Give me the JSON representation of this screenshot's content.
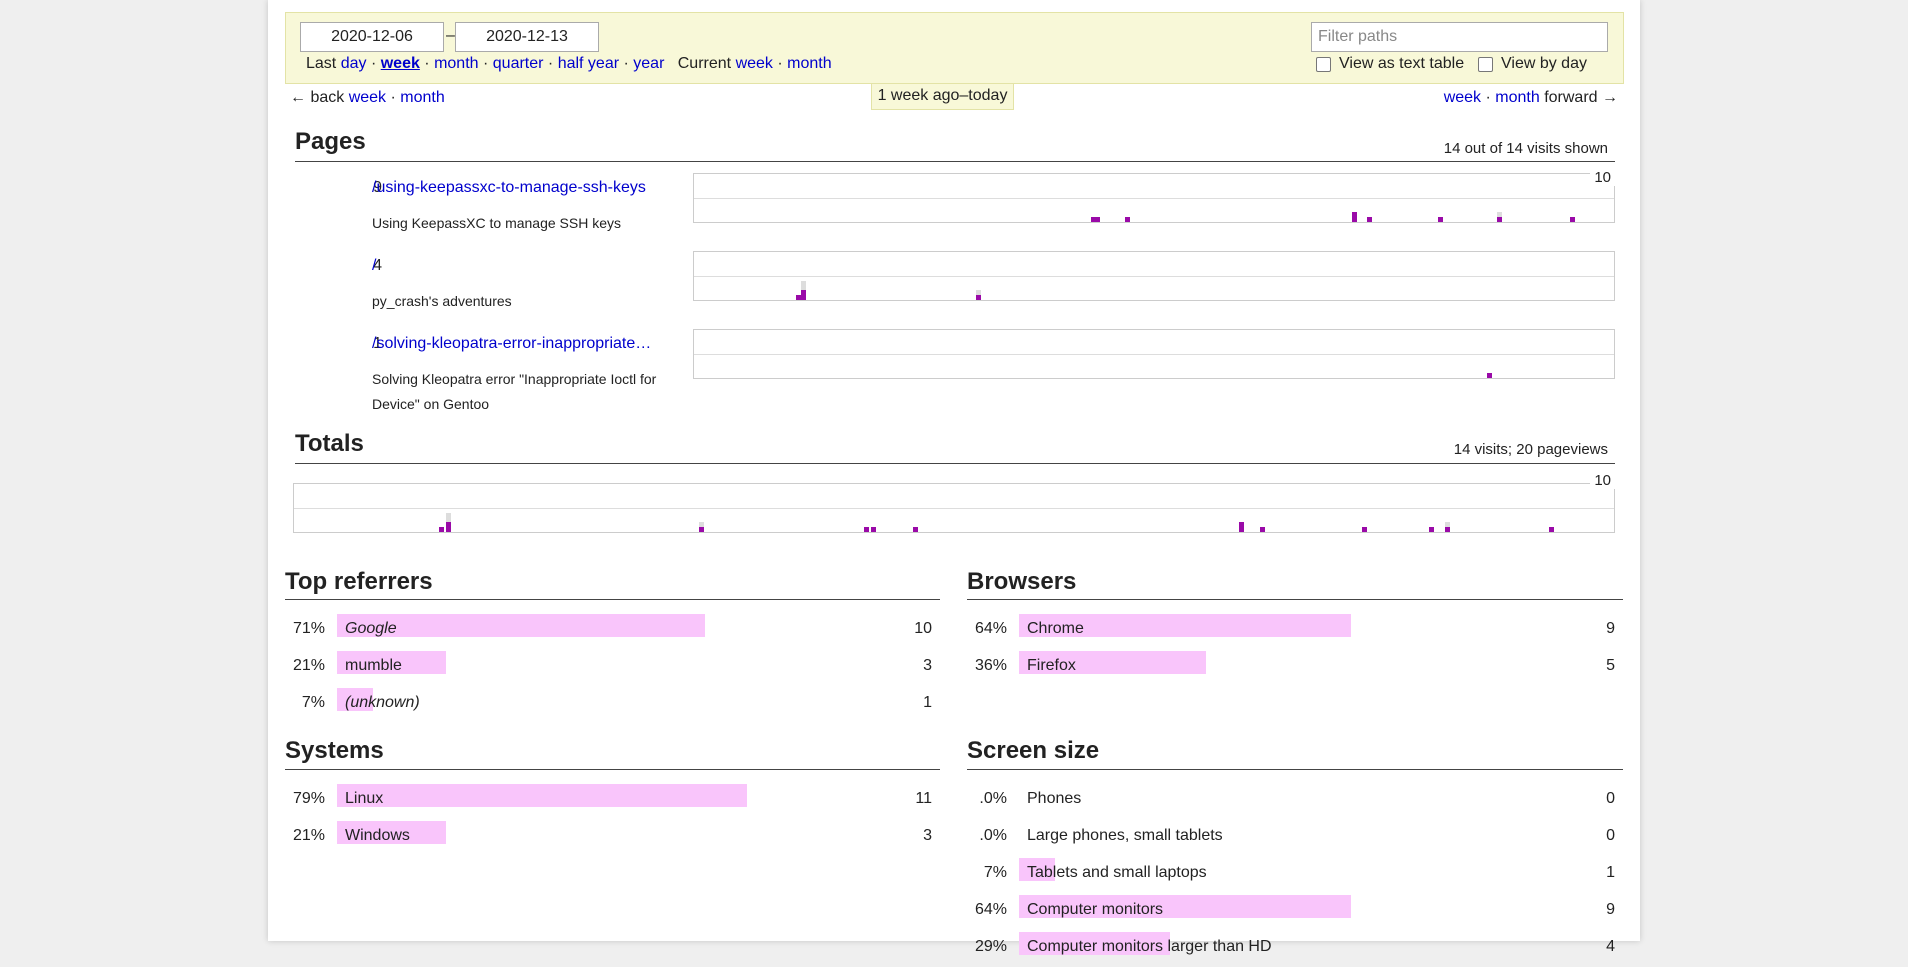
{
  "filter": {
    "start_date": "2020-12-06",
    "end_date": "2020-12-13",
    "dash": "–",
    "last_label": "Last",
    "last_periods": [
      "day",
      "week",
      "month",
      "quarter",
      "half year",
      "year"
    ],
    "selected_period": "week",
    "current_label": "Current",
    "current_periods": [
      "week",
      "month"
    ],
    "filter_placeholder": "Filter paths",
    "view_text_table": "View as text table",
    "view_by_day": "View by day"
  },
  "nav": {
    "back_label": "← back",
    "back_week": "week",
    "back_month": "month",
    "forward_week": "week",
    "forward_month": "month",
    "forward_label": "forward →",
    "sep": "·",
    "current_range": "1 week ago–today"
  },
  "pages": {
    "title": "Pages",
    "info": "14 out of 14 visits shown",
    "max_label": "10",
    "rows": [
      {
        "count": "9",
        "path": "/using-keepassxc-to-manage-ssh-keys",
        "title": "Using KeepassXC to manage SSH keys",
        "bars": [
          {
            "x": 0.431,
            "pv": 1,
            "vi": 1
          },
          {
            "x": 0.436,
            "pv": 1,
            "vi": 1
          },
          {
            "x": 0.469,
            "pv": 1,
            "vi": 1
          },
          {
            "x": 0.715,
            "pv": 2,
            "vi": 2
          },
          {
            "x": 0.732,
            "pv": 1,
            "vi": 1
          },
          {
            "x": 0.809,
            "pv": 1,
            "vi": 1
          },
          {
            "x": 0.873,
            "pv": 2,
            "vi": 1
          },
          {
            "x": 0.952,
            "pv": 1,
            "vi": 1
          }
        ]
      },
      {
        "count": "4",
        "path": "/",
        "title": "py_crash's adventures",
        "bars": [
          {
            "x": 0.111,
            "pv": 1,
            "vi": 1
          },
          {
            "x": 0.116,
            "pv": 4,
            "vi": 2
          },
          {
            "x": 0.306,
            "pv": 2,
            "vi": 1
          }
        ]
      },
      {
        "count": "1",
        "path": "/solving-kleopatra-error-inappropriate…",
        "title": "Solving Kleopatra error \"Inappropriate Ioctl for Device\" on Gentoo",
        "bars": [
          {
            "x": 0.862,
            "pv": 1,
            "vi": 1
          }
        ]
      }
    ]
  },
  "totals": {
    "title": "Totals",
    "info": "14 visits; 20 pageviews",
    "max_label": "10",
    "bars": [
      {
        "x": 0.11,
        "pv": 1,
        "vi": 1
      },
      {
        "x": 0.115,
        "pv": 4,
        "vi": 2
      },
      {
        "x": 0.307,
        "pv": 2,
        "vi": 1
      },
      {
        "x": 0.432,
        "pv": 1,
        "vi": 1
      },
      {
        "x": 0.437,
        "pv": 1,
        "vi": 1
      },
      {
        "x": 0.469,
        "pv": 1,
        "vi": 1
      },
      {
        "x": 0.716,
        "pv": 2,
        "vi": 2
      },
      {
        "x": 0.732,
        "pv": 1,
        "vi": 1
      },
      {
        "x": 0.809,
        "pv": 1,
        "vi": 1
      },
      {
        "x": 0.86,
        "pv": 1,
        "vi": 1
      },
      {
        "x": 0.872,
        "pv": 2,
        "vi": 1
      },
      {
        "x": 0.951,
        "pv": 1,
        "vi": 1
      }
    ]
  },
  "referrers": {
    "title": "Top referrers",
    "rows": [
      {
        "pct": "71%",
        "label": "Google",
        "count": "10",
        "fraction": 0.71,
        "italic": true
      },
      {
        "pct": "21%",
        "label": "mumble",
        "count": "3",
        "fraction": 0.21,
        "italic": false
      },
      {
        "pct": "7%",
        "label": "(unknown)",
        "count": "1",
        "fraction": 0.07,
        "italic": true
      }
    ]
  },
  "browsers": {
    "title": "Browsers",
    "rows": [
      {
        "pct": "64%",
        "label": "Chrome",
        "count": "9",
        "fraction": 0.64,
        "italic": false
      },
      {
        "pct": "36%",
        "label": "Firefox",
        "count": "5",
        "fraction": 0.36,
        "italic": false
      }
    ]
  },
  "systems": {
    "title": "Systems",
    "rows": [
      {
        "pct": "79%",
        "label": "Linux",
        "count": "11",
        "fraction": 0.79,
        "italic": false
      },
      {
        "pct": "21%",
        "label": "Windows",
        "count": "3",
        "fraction": 0.21,
        "italic": false
      }
    ]
  },
  "screen": {
    "title": "Screen size",
    "rows": [
      {
        "pct": ".0%",
        "label": "Phones",
        "count": "0",
        "fraction": 0,
        "italic": false
      },
      {
        "pct": ".0%",
        "label": "Large phones, small tablets",
        "count": "0",
        "fraction": 0,
        "italic": false
      },
      {
        "pct": "7%",
        "label": "Tablets and small laptops",
        "count": "1",
        "fraction": 0.07,
        "italic": false
      },
      {
        "pct": "64%",
        "label": "Computer monitors",
        "count": "9",
        "fraction": 0.64,
        "italic": false
      },
      {
        "pct": "29%",
        "label": "Computer monitors larger than HD",
        "count": "4",
        "fraction": 0.29,
        "italic": false
      }
    ]
  }
}
